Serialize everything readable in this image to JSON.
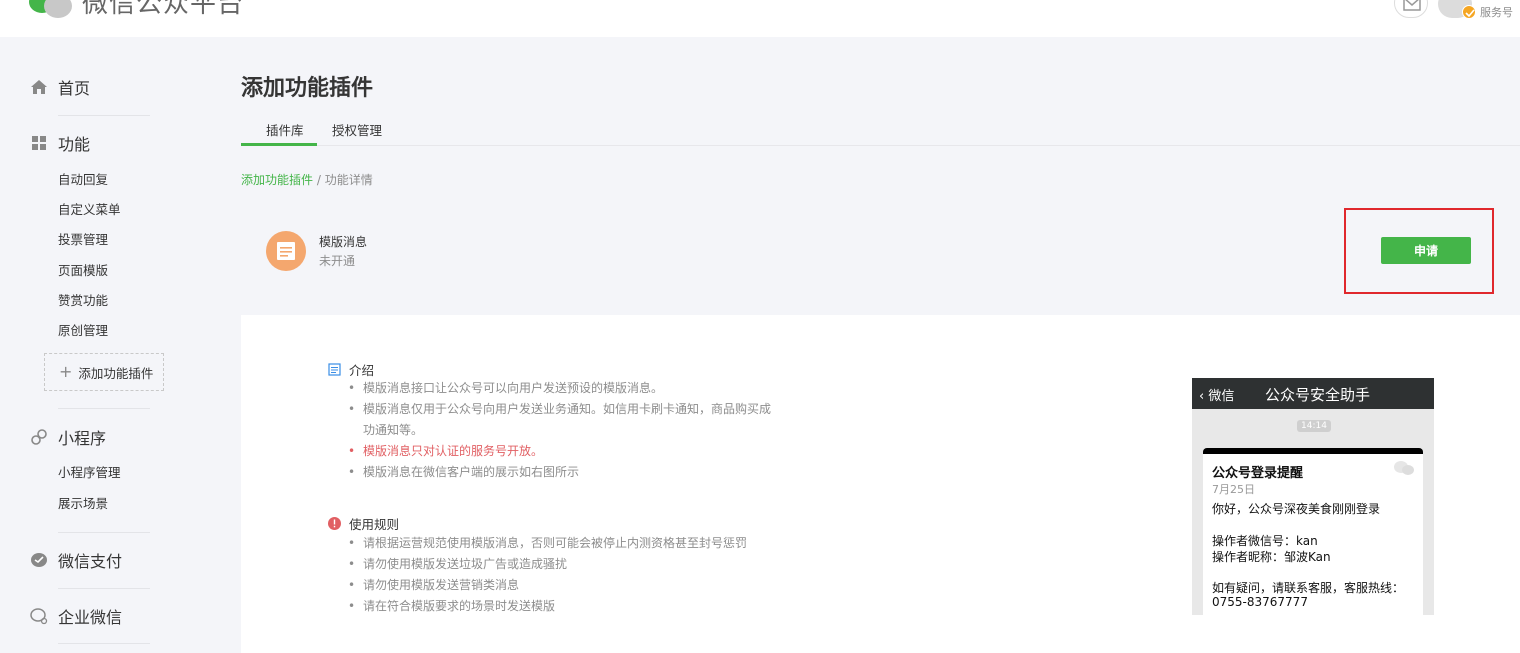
{
  "header": {
    "logo_text": "微信公众平台",
    "account_type": "服务号"
  },
  "sidebar": {
    "home": "首页",
    "functions": "功能",
    "function_items": [
      "自动回复",
      "自定义菜单",
      "投票管理",
      "页面模版",
      "赞赏功能",
      "原创管理"
    ],
    "add_plugin": "添加功能插件",
    "miniprogram": "小程序",
    "miniprogram_items": [
      "小程序管理",
      "展示场景"
    ],
    "pay": "微信支付",
    "work_wechat": "企业微信"
  },
  "main": {
    "title": "添加功能插件",
    "tabs": [
      {
        "label": "插件库"
      },
      {
        "label": "授权管理"
      }
    ],
    "breadcrumb": {
      "link": "添加功能插件",
      "sep": " / ",
      "current": "功能详情"
    },
    "plugin": {
      "name": "模版消息",
      "status": "未开通",
      "apply_label": "申请"
    },
    "intro": {
      "heading": "介绍",
      "bullets": [
        "模版消息接口让公众号可以向用户发送预设的模版消息。",
        "模版消息仅用于公众号向用户发送业务通知。如信用卡刷卡通知，商品购买成",
        "功通知等。",
        "模版消息只对认证的服务号开放。",
        "模版消息在微信客户端的展示如右图所示"
      ]
    },
    "rules": {
      "heading": "使用规则",
      "bullets": [
        "请根据运营规范使用模版消息，否则可能会被停止内测资格甚至封号惩罚",
        "请勿使用模版发送垃圾广告或造成骚扰",
        "请勿使用模版发送营销类消息",
        "请在符合模版要求的场景时发送模版"
      ]
    }
  },
  "preview": {
    "back": "微信",
    "title": "公众号安全助手",
    "time": "14:14",
    "card_title": "公众号登录提醒",
    "date": "7月25日",
    "greeting": "你好，公众号深夜美食刚刚登录",
    "operator_id": "操作者微信号：kan",
    "operator_nick": "操作者昵称：邹波Kan",
    "help": "如有疑问，请联系客服，客服热线：",
    "hotline": "0755-83767777"
  },
  "colors": {
    "accent": "#44b549",
    "highlight": "#e0282d",
    "warning": "#e15f63",
    "plugin_icon": "#f4a76e"
  }
}
